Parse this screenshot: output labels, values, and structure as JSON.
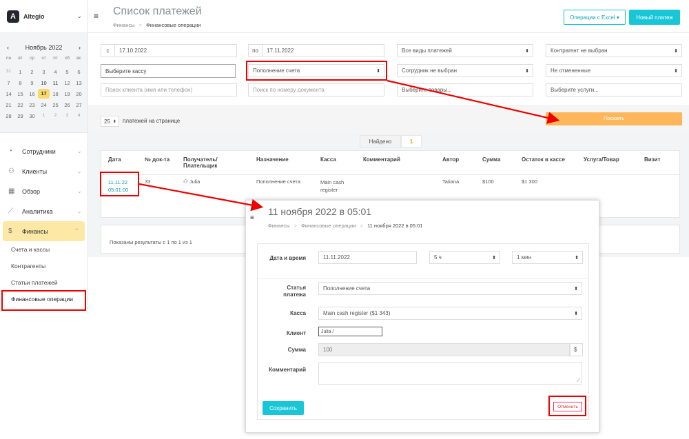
{
  "brand": {
    "name": "Altegio",
    "logo": "A"
  },
  "calendar": {
    "month": "Ноябрь 2022",
    "prev": "‹",
    "next": "›",
    "dow": [
      "пн",
      "вт",
      "ср",
      "чт",
      "пт",
      "сб",
      "вс"
    ],
    "weeks": [
      [
        "31",
        "1",
        "2",
        "3",
        "4",
        "5",
        "6"
      ],
      [
        "7",
        "8",
        "9",
        "10",
        "11",
        "12",
        "13"
      ],
      [
        "14",
        "15",
        "16",
        "17",
        "18",
        "19",
        "20"
      ],
      [
        "21",
        "22",
        "23",
        "24",
        "25",
        "26",
        "27"
      ],
      [
        "28",
        "29",
        "30",
        "1",
        "2",
        "3",
        "4"
      ]
    ],
    "today": "17"
  },
  "nav": {
    "items": [
      {
        "label": "Сотрудники",
        "icon": "user-circle-icon"
      },
      {
        "label": "Клиенты",
        "icon": "users-icon"
      },
      {
        "label": "Обзор",
        "icon": "grid-icon"
      },
      {
        "label": "Аналитика",
        "icon": "chart-icon"
      },
      {
        "label": "Финансы",
        "icon": "dollar-icon"
      }
    ],
    "sub": [
      "Счета и кассы",
      "Контрагенты",
      "Статьи платежей",
      "Финансовые операции"
    ]
  },
  "header": {
    "title": "Список платежей",
    "crumb1": "Финансы",
    "crumb_sep": ">",
    "crumb2": "Финансовые операции",
    "excel": "Операции с Excel ▾",
    "new": "Новый платеж"
  },
  "filters": {
    "from_prefix": "с",
    "from": "17.10.2022",
    "to_prefix": "по",
    "to": "17.11.2022",
    "types": "Все виды платежей",
    "counterparty": "Контрагент не выбран",
    "cash": "Выберите кассу",
    "purpose": "Пополнение счета",
    "employee": "Сотрудник не выбран",
    "status": "Не отмененные",
    "client_ph": "Поиск клиента (имя или телефон)",
    "doc_ph": "Поиск по номеру документа",
    "goods_ph": "Выберите товары...",
    "services_ph": "Выберите услуги..."
  },
  "perpage": {
    "value": "25",
    "label": "платежей на странице"
  },
  "show_btn": "Показать",
  "found": {
    "label": "Найдено",
    "count": "1"
  },
  "table": {
    "headers": [
      "Дата",
      "№ док-та",
      "Получатель/ Плательщик",
      "Назначение",
      "Касса",
      "Комментарий",
      "Автор",
      "Сумма",
      "Остаток в кассе",
      "Услуга/Товар",
      "Визит"
    ],
    "row": {
      "date": "11.11.22",
      "time": "05:01:00",
      "doc": "33",
      "payer": "Julia",
      "purpose": "Пополнение счета",
      "cash": "Main cash register",
      "comment": "",
      "author": "Tatiana",
      "sum": "$100",
      "rest": "$1 300"
    }
  },
  "pager": "Показаны результаты с 1 по 1 из 1",
  "modal": {
    "title": "11 ноября 2022 в 05:01",
    "crumb1": "Финансы",
    "crumb2": "Финансовые операции",
    "crumb3": "11 ноября 2022 в 05:01",
    "date_label": "Дата и время",
    "date": "11.11.2022",
    "hour": "5 ч",
    "minute": "1 мин",
    "item_label": "Статья платежа",
    "item": "Пополнение счета",
    "cash_label": "Касса",
    "cash": "Main cash register ($1 343)",
    "client_label": "Клиент",
    "client": "Julia /",
    "sum_label": "Сумма",
    "sum": "100",
    "currency": "$",
    "comment_label": "Комментарий",
    "save": "Сохранить",
    "cancel": "Отменить"
  },
  "colors": {
    "accent": "#18c6d8",
    "orange": "#fdb659",
    "highlight": "#e00000",
    "active_nav": "#fde8a6"
  }
}
